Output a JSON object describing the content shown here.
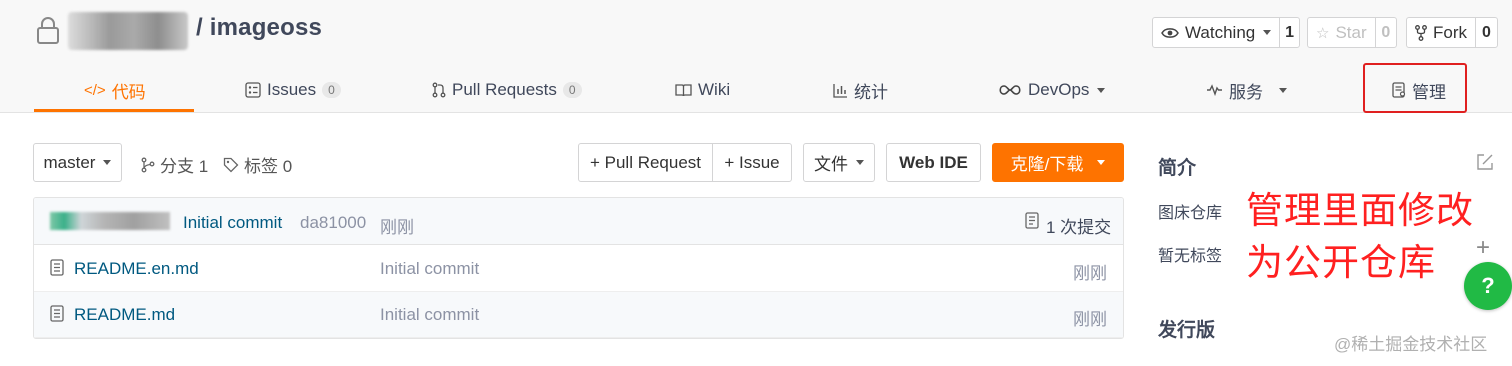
{
  "repo": {
    "name": "/ imageoss"
  },
  "header_buttons": {
    "watching_label": "Watching",
    "watching_count": "1",
    "star_label": "Star",
    "star_count": "0",
    "fork_label": "Fork",
    "fork_count": "0"
  },
  "tabs": [
    {
      "label": "代码",
      "icon": "code-icon",
      "active": true
    },
    {
      "label": "Issues",
      "badge": "0",
      "icon": "issues-icon"
    },
    {
      "label": "Pull Requests",
      "badge": "0",
      "icon": "pull-request-icon"
    },
    {
      "label": "Wiki",
      "icon": "wiki-icon"
    },
    {
      "label": "统计",
      "icon": "stats-icon"
    },
    {
      "label": "DevOps",
      "icon": "devops-icon",
      "dropdown": true
    },
    {
      "label": "服务",
      "icon": "service-icon",
      "dropdown": true
    },
    {
      "label": "管理",
      "icon": "manage-icon"
    }
  ],
  "toolbar": {
    "branch": "master",
    "branches_label": "分支 1",
    "tags_label": "标签 0",
    "pull_request": "+ Pull Request",
    "issue": "+ Issue",
    "file_menu": "文件",
    "web_ide": "Web IDE",
    "clone_download": "克隆/下载"
  },
  "latest_commit": {
    "message": "Initial commit",
    "hash": "da81000",
    "time": "刚刚",
    "commits_count": "1 次提交"
  },
  "files": [
    {
      "name": "README.en.md",
      "commit": "Initial commit",
      "time": "刚刚"
    },
    {
      "name": "README.md",
      "commit": "Initial commit",
      "time": "刚刚"
    }
  ],
  "sidebar": {
    "intro_title": "简介",
    "description": "图床仓库",
    "no_tags": "暂无标签",
    "releases_title": "发行版"
  },
  "annotation": {
    "line1": "管理里面修改",
    "line2": "为公开仓库"
  },
  "help_button": "?",
  "watermark": "@稀土掘金技术社区",
  "colors": {
    "accent": "#fe7300",
    "link": "#005980",
    "annotation": "#ff2020",
    "help": "#21ba45"
  }
}
